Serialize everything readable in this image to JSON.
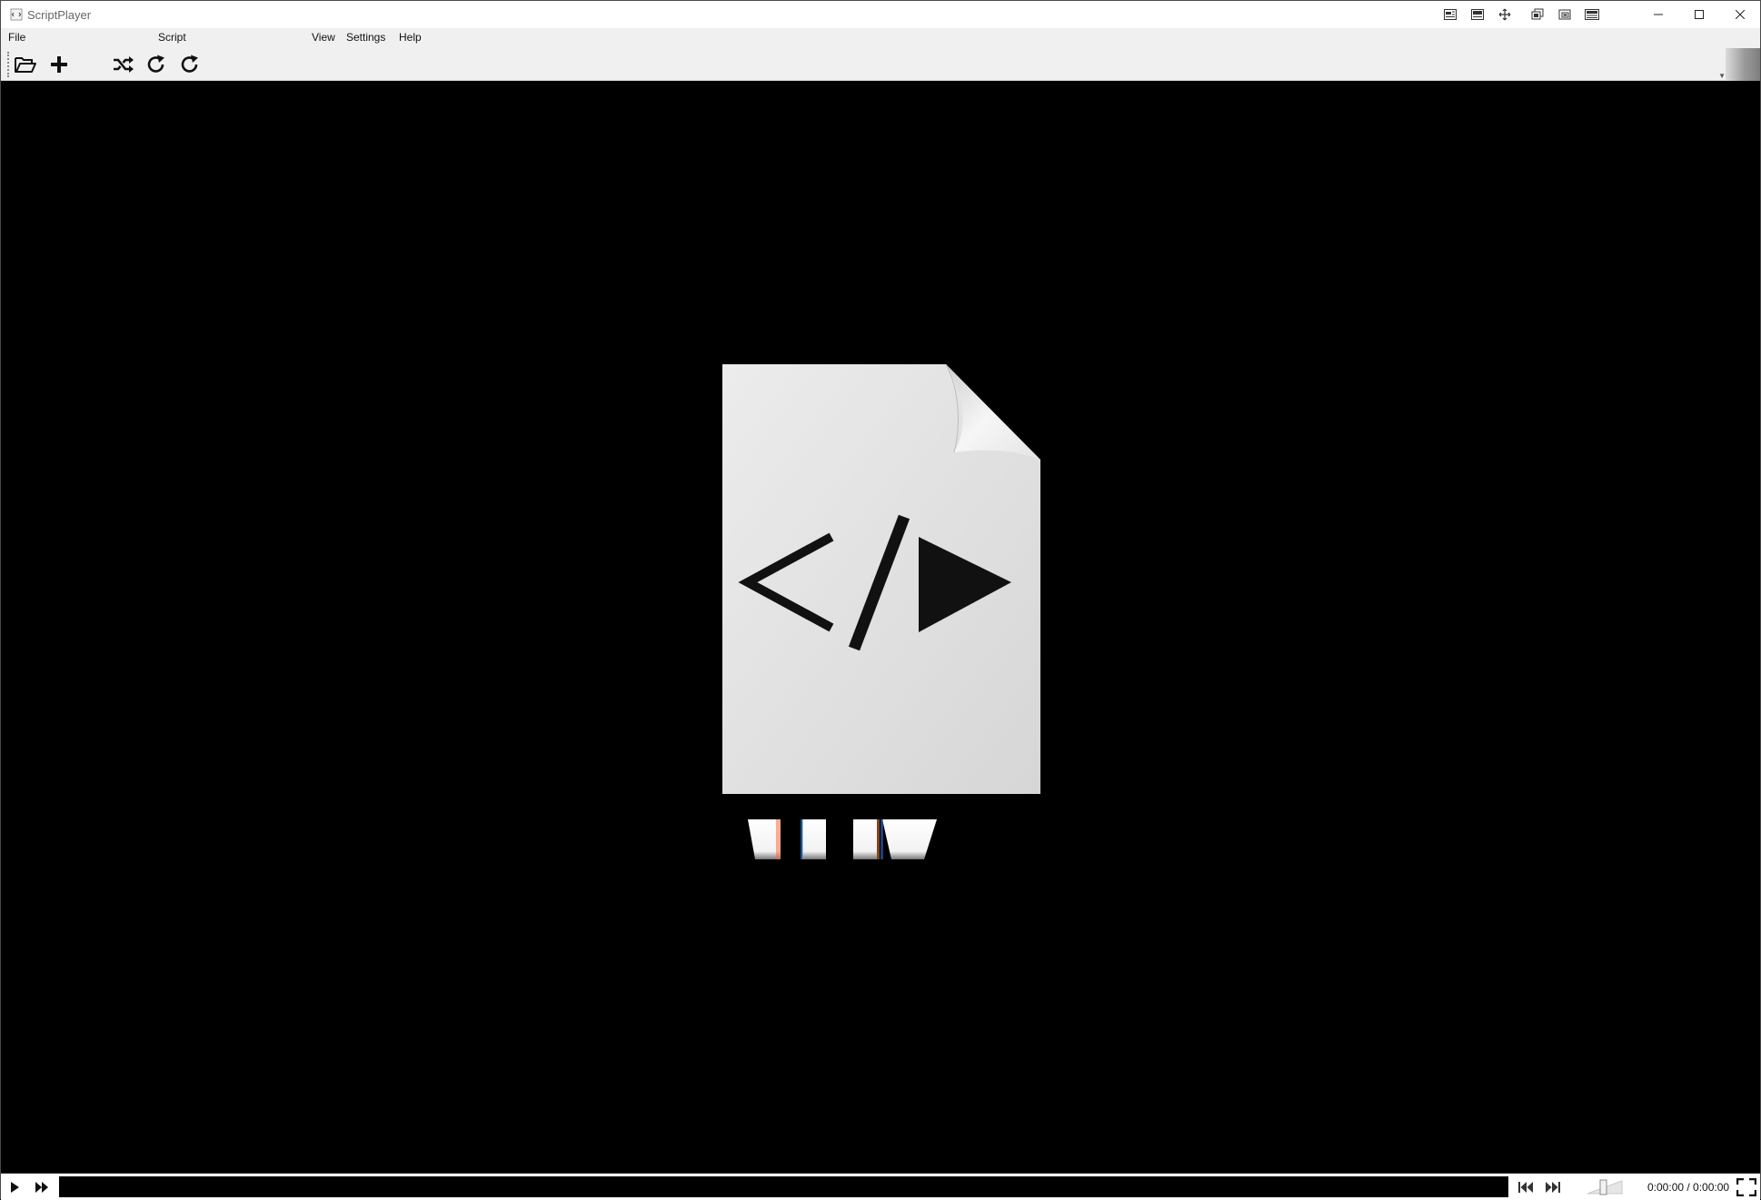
{
  "window": {
    "title": "ScriptPlayer"
  },
  "menu": {
    "file": "File",
    "script": "Script",
    "view": "View",
    "settings": "Settings",
    "help": "Help"
  },
  "toolbar": {
    "buttons": [
      {
        "name": "open",
        "icon": "folder-open-icon"
      },
      {
        "name": "add",
        "icon": "plus-icon"
      },
      {
        "name": "shuffle",
        "icon": "shuffle-icon"
      },
      {
        "name": "repeat",
        "icon": "repeat-icon"
      },
      {
        "name": "repeat-one",
        "icon": "repeat-icon"
      }
    ]
  },
  "title_tools": [
    "layout-icon-1",
    "layout-icon-2",
    "move-icon",
    "layers-icon",
    "overlay-icon",
    "panel-icon"
  ],
  "player": {
    "placeholder_icon": "script-file-icon",
    "time_display": "0:00:00 / 0:00:00",
    "volume_level": 0.45,
    "progress": 0
  },
  "colors": {
    "background": "#000000",
    "chrome": "#f0f0f0",
    "placeholder_page": "#e2e2e2"
  }
}
